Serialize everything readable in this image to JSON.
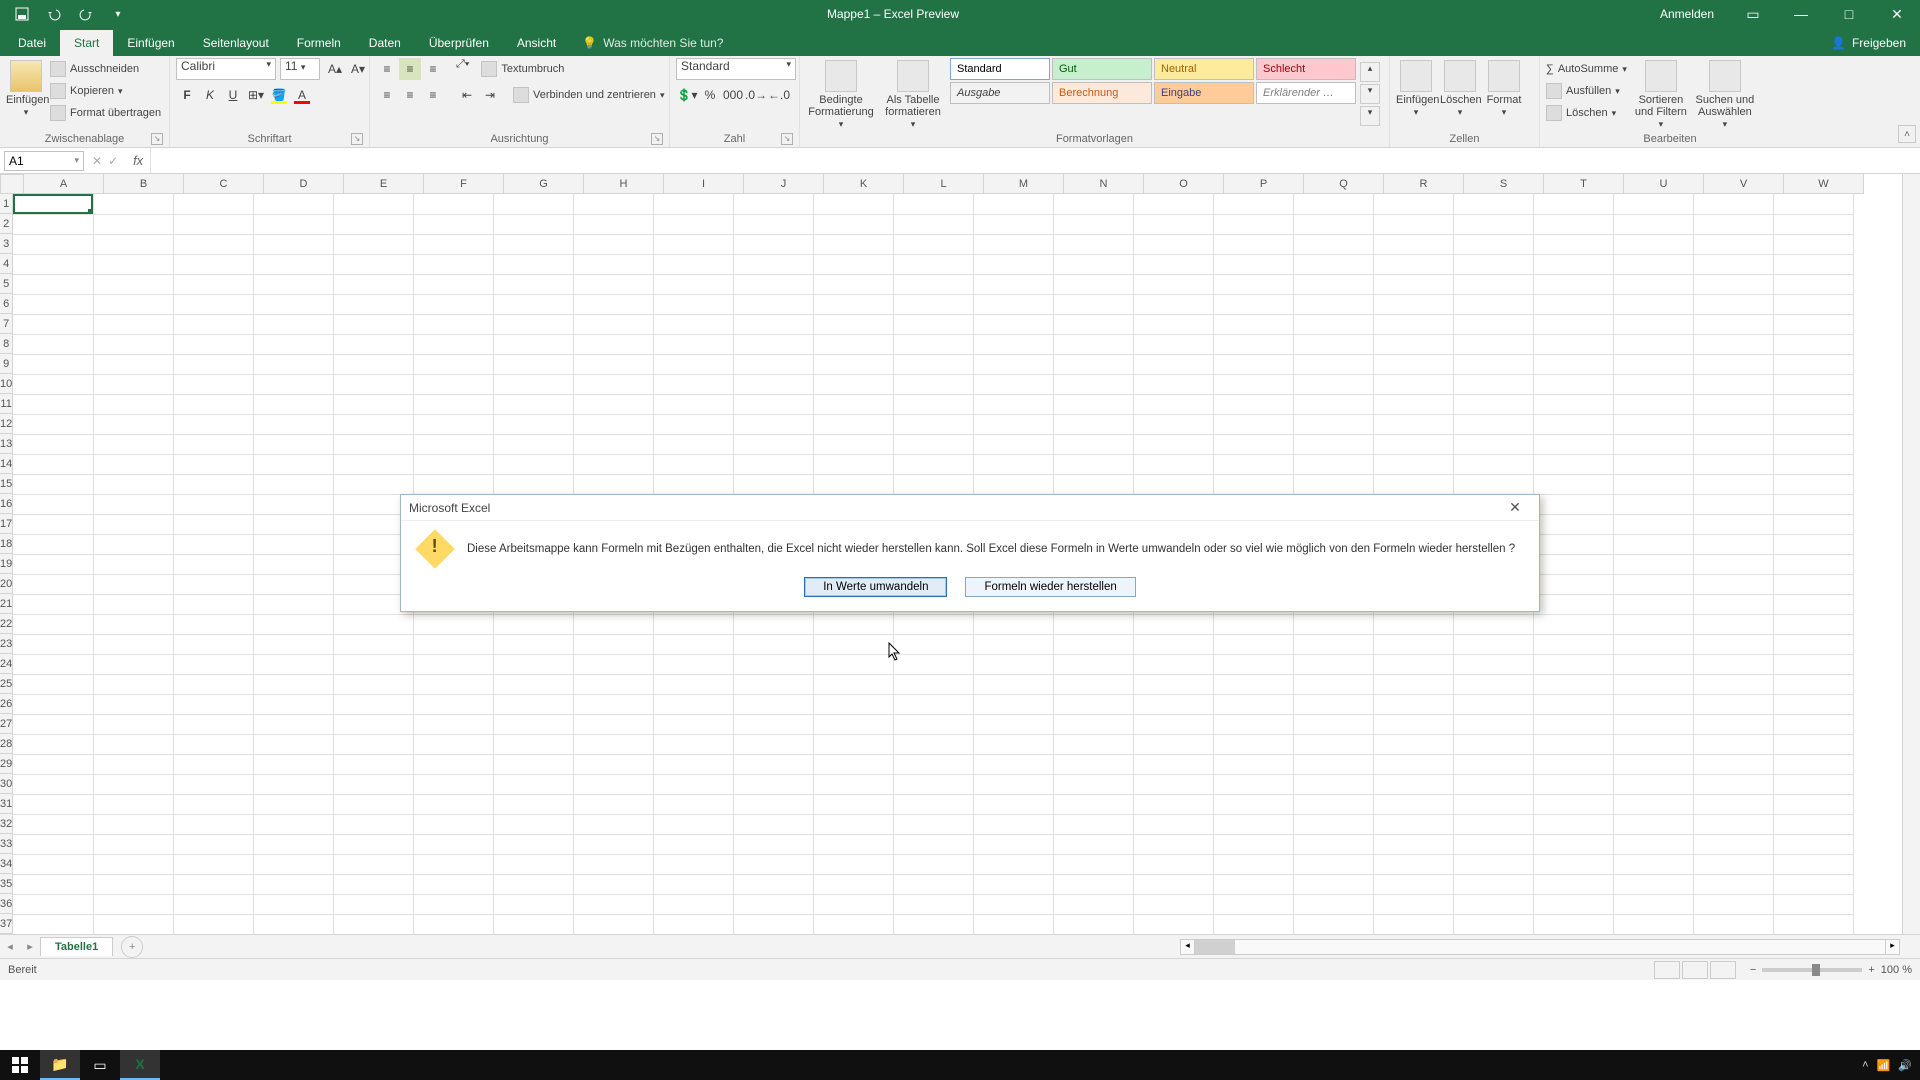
{
  "title": "Mappe1 – Excel Preview",
  "signin": "Anmelden",
  "tabs": {
    "file": "Datei",
    "home": "Start",
    "insert": "Einfügen",
    "layout": "Seitenlayout",
    "formulas": "Formeln",
    "data": "Daten",
    "review": "Überprüfen",
    "view": "Ansicht",
    "tellme_placeholder": "Was möchten Sie tun?",
    "share": "Freigeben"
  },
  "ribbon": {
    "clipboard": {
      "label": "Zwischenablage",
      "paste": "Einfügen",
      "cut": "Ausschneiden",
      "copy": "Kopieren",
      "format_painter": "Format übertragen"
    },
    "font": {
      "label": "Schriftart",
      "name": "Calibri",
      "size": "11"
    },
    "alignment": {
      "label": "Ausrichtung",
      "wrap": "Textumbruch",
      "merge": "Verbinden und zentrieren"
    },
    "number": {
      "label": "Zahl",
      "format": "Standard"
    },
    "styles": {
      "label": "Formatvorlagen",
      "cond": "Bedingte Formatierung",
      "table": "Als Tabelle formatieren",
      "cells": [
        {
          "t": "Standard",
          "bg": "#ffffff",
          "fg": "#000000",
          "bd": "#7fa8d9"
        },
        {
          "t": "Gut",
          "bg": "#c6efce",
          "fg": "#006100"
        },
        {
          "t": "Neutral",
          "bg": "#ffeb9c",
          "fg": "#9c6500"
        },
        {
          "t": "Schlecht",
          "bg": "#ffc7ce",
          "fg": "#9c0006"
        },
        {
          "t": "Ausgabe",
          "bg": "#f2f2f2",
          "fg": "#3f3f3f",
          "it": true
        },
        {
          "t": "Berechnung",
          "bg": "#fde9d9",
          "fg": "#c65911"
        },
        {
          "t": "Eingabe",
          "bg": "#ffcc99",
          "fg": "#3f3f76"
        },
        {
          "t": "Erklärender …",
          "bg": "#ffffff",
          "fg": "#7f7f7f",
          "it": true
        }
      ]
    },
    "cells_grp": {
      "label": "Zellen",
      "insert": "Einfügen",
      "delete": "Löschen",
      "format": "Format"
    },
    "editing": {
      "label": "Bearbeiten",
      "autosum": "AutoSumme",
      "fill": "Ausfüllen",
      "clear": "Löschen",
      "sort": "Sortieren und Filtern",
      "find": "Suchen und Auswählen"
    }
  },
  "namebox": "A1",
  "columns": [
    "A",
    "B",
    "C",
    "D",
    "E",
    "F",
    "G",
    "H",
    "I",
    "J",
    "K",
    "L",
    "M",
    "N",
    "O",
    "P",
    "Q",
    "R",
    "S",
    "T",
    "U",
    "V",
    "W"
  ],
  "row_count": 38,
  "sheet_tab": "Tabelle1",
  "status_ready": "Bereit",
  "zoom": "100 %",
  "dialog": {
    "title": "Microsoft Excel",
    "message": "Diese Arbeitsmappe kann Formeln mit Bezügen enthalten, die Excel nicht wieder herstellen kann. Soll Excel diese Formeln in Werte umwandeln oder so viel wie möglich von den Formeln wieder herstellen ?",
    "btn_convert": "In Werte umwandeln",
    "btn_recover": "Formeln wieder herstellen"
  }
}
